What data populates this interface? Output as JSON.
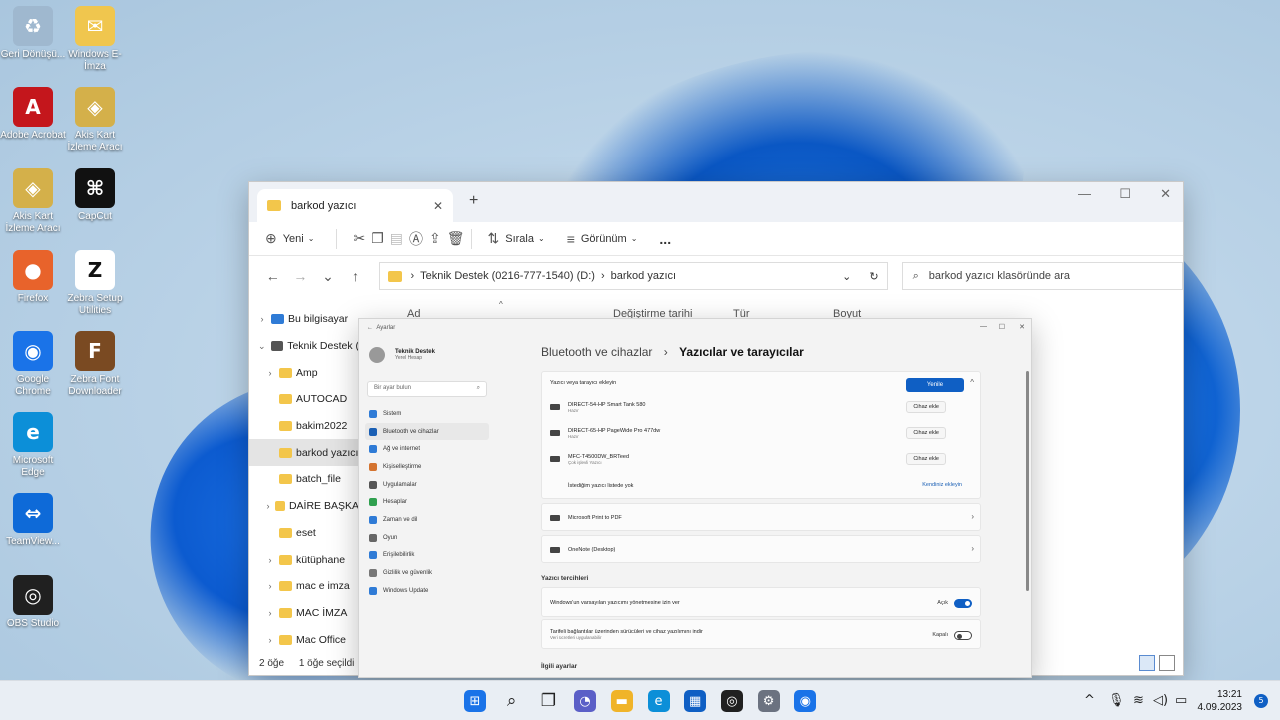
{
  "desktop": {
    "icons": [
      {
        "label": "Geri Dönüşü...",
        "icon": "recycle-bin-icon",
        "color": "#9fb8cf"
      },
      {
        "label": "Windows E-İmza",
        "icon": "folder-icon",
        "color": "#f0c64e"
      },
      {
        "label": "Adobe Acrobat",
        "icon": "acrobat-icon",
        "color": "#c4161c"
      },
      {
        "label": "Akis Kart İzleme Aracı",
        "icon": "smartcard-icon",
        "color": "#d4b04a"
      },
      {
        "label": "Akis Kart İzleme Aracı",
        "icon": "smartcard-icon",
        "color": "#d4b04a"
      },
      {
        "label": "CapCut",
        "icon": "capcut-icon",
        "color": "#111111"
      },
      {
        "label": "Firefox",
        "icon": "firefox-icon",
        "color": "#e8632b"
      },
      {
        "label": "Zebra Setup Utilities",
        "icon": "zebra-icon",
        "color": "#ffffff"
      },
      {
        "label": "Google Chrome",
        "icon": "chrome-icon",
        "color": "#1a73e8"
      },
      {
        "label": "Zebra Font Downloader",
        "icon": "font-downloader-icon",
        "color": "#7a4a22"
      },
      {
        "label": "Microsoft Edge",
        "icon": "edge-icon",
        "color": "#0c8fd8"
      },
      {
        "label": "TeamView...",
        "icon": "teamviewer-icon",
        "color": "#0e6ad8"
      },
      {
        "label": "OBS Studio",
        "icon": "obs-icon",
        "color": "#202020"
      }
    ]
  },
  "explorer": {
    "tab_title": "barkod yazıcı",
    "toolbar": {
      "new": "Yeni",
      "sort": "Sırala",
      "view": "Görünüm",
      "more": "..."
    },
    "address": {
      "drive": "Teknik Destek (0216-777-1540) (D:)",
      "folder": "barkod yazıcı",
      "search_placeholder": "barkod yazıcı klasöründe ara"
    },
    "columns": {
      "name": "Ad",
      "date": "Değiştirme tarihi",
      "type": "Tür",
      "size": "Boyut"
    },
    "nav": [
      {
        "label": "Bu bilgisayar",
        "chevron": ">"
      },
      {
        "label": "Teknik Destek (",
        "chevron": "v"
      },
      {
        "label": "Amp",
        "chevron": ">"
      },
      {
        "label": "AUTOCAD",
        "chevron": ""
      },
      {
        "label": "bakim2022",
        "chevron": ""
      },
      {
        "label": "barkod yazıcı",
        "chevron": "",
        "selected": true
      },
      {
        "label": "batch_file",
        "chevron": ""
      },
      {
        "label": "DAİRE BAŞKA",
        "chevron": ">"
      },
      {
        "label": "eset",
        "chevron": ""
      },
      {
        "label": "kütüphane",
        "chevron": ">"
      },
      {
        "label": "mac e imza",
        "chevron": ">"
      },
      {
        "label": "MAC İMZA",
        "chevron": ">"
      },
      {
        "label": "Mac Office",
        "chevron": ">"
      }
    ],
    "status": {
      "count": "2 öğe",
      "selected": "1 öğe seçildi"
    }
  },
  "settings": {
    "window_title": "Ayarlar",
    "user": {
      "name": "Teknik Destek",
      "sub": "Yerel Hesap"
    },
    "search_placeholder": "Bir ayar bulun",
    "nav": [
      {
        "label": "Sistem",
        "color": "#2f7bd6"
      },
      {
        "label": "Bluetooth ve cihazlar",
        "color": "#1a5fb4",
        "selected": true
      },
      {
        "label": "Ağ ve internet",
        "color": "#2f7bd6"
      },
      {
        "label": "Kişiselleştirme",
        "color": "#d4732f"
      },
      {
        "label": "Uygulamalar",
        "color": "#555555"
      },
      {
        "label": "Hesaplar",
        "color": "#2fa04f"
      },
      {
        "label": "Zaman ve dil",
        "color": "#2f7bd6"
      },
      {
        "label": "Oyun",
        "color": "#666666"
      },
      {
        "label": "Erişilebilirlik",
        "color": "#2f7bd6"
      },
      {
        "label": "Gizlilik ve güvenlik",
        "color": "#777777"
      },
      {
        "label": "Windows Update",
        "color": "#2f7bd6"
      }
    ],
    "breadcrumb": {
      "parent": "Bluetooth ve cihazlar",
      "current": "Yazıcılar ve tarayıcılar"
    },
    "add_section": {
      "label": "Yazıcı veya tarayıcı ekleyin",
      "button": "Yenile"
    },
    "printers": [
      {
        "name": "DIRECT-54-HP Smart Tank 580",
        "sub": "Hazır",
        "action": "Cihaz ekle"
      },
      {
        "name": "DIRECT-65-HP PageWide Pro 477dw",
        "sub": "Hazır",
        "action": "Cihaz ekle"
      },
      {
        "name": "MFC-T4500DW_BRTeed",
        "sub": "Çok işlevli Yazıcı",
        "action": "Cihaz ekle"
      }
    ],
    "not_listed": {
      "label": "İstediğim yazıcı listede yok",
      "action": "Kendiniz ekleyin"
    },
    "installed": [
      {
        "name": "Microsoft Print to PDF"
      },
      {
        "name": "OneNote (Desktop)"
      }
    ],
    "prefs_heading": "Yazıcı tercihleri",
    "prefs": [
      {
        "label": "Windows'un varsayılan yazıcımı yönetmesine izin ver",
        "sub": "",
        "state": "Açık",
        "on": true
      },
      {
        "label": "Tarifeli bağlantılar üzerinden sürücüleri ve cihaz yazılımını indir",
        "sub": "Veri ücretleri uygulanabilir",
        "state": "Kapalı",
        "on": false
      }
    ],
    "related_heading": "İlgili ayarlar"
  },
  "taskbar": {
    "apps": [
      {
        "icon": "start-icon",
        "color": "#1a73e8"
      },
      {
        "icon": "search-icon",
        "color": "#222222"
      },
      {
        "icon": "task-view-icon",
        "color": "#222222"
      },
      {
        "icon": "teams-chat-icon",
        "color": "#5b5fc7"
      },
      {
        "icon": "file-explorer-icon",
        "color": "#f0b429"
      },
      {
        "icon": "edge-icon",
        "color": "#0c8fd8"
      },
      {
        "icon": "store-icon",
        "color": "#0f5fc4"
      },
      {
        "icon": "obs-icon",
        "color": "#202020"
      },
      {
        "icon": "settings-icon",
        "color": "#6b7280"
      },
      {
        "icon": "chrome-icon",
        "color": "#1a73e8"
      }
    ],
    "time": "13:21",
    "date": "4.09.2023",
    "notifications": "5"
  }
}
